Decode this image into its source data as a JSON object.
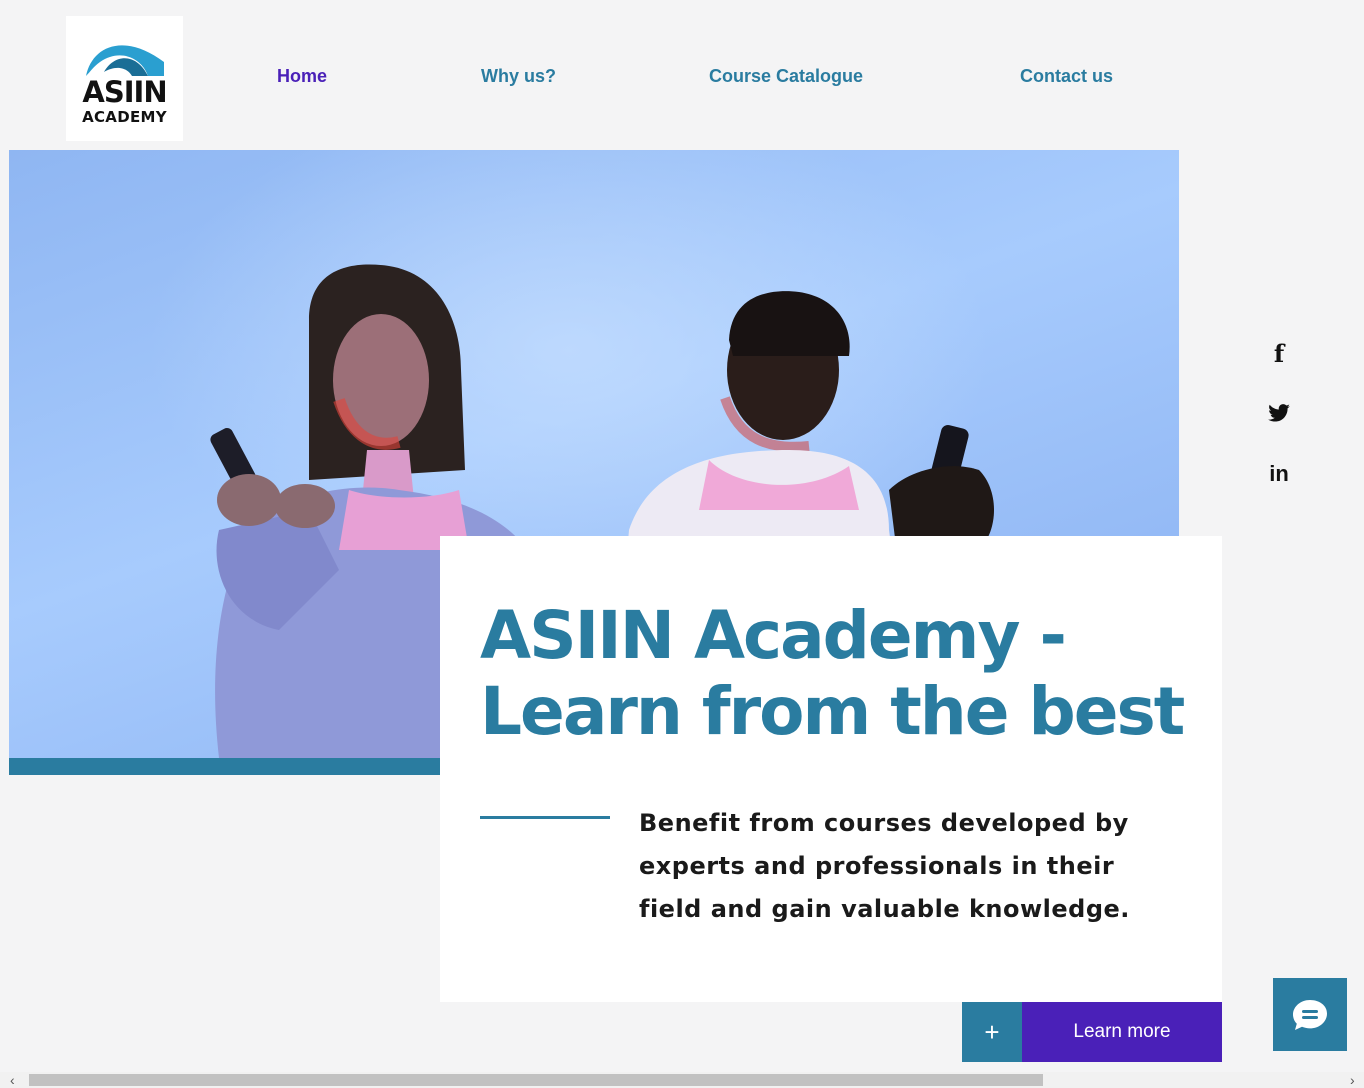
{
  "brand": {
    "logo_title": "ASIIN",
    "logo_subtitle": "ACADEMY",
    "colors": {
      "primary": "#2a7ca0",
      "accent": "#4a20b8"
    }
  },
  "nav": {
    "items": [
      {
        "label": "Home",
        "active": true
      },
      {
        "label": "Why us?"
      },
      {
        "label": "Course Catalogue"
      },
      {
        "label": "Contact us"
      }
    ]
  },
  "social": {
    "facebook_icon": "f",
    "linkedin_icon": "in",
    "icons": [
      "facebook-icon",
      "twitter-icon",
      "linkedin-icon"
    ]
  },
  "hero": {
    "headline_line1": "ASIIN Academy -",
    "headline_line2": "Learn from the best",
    "description": "Benefit from courses developed by experts and professionals in their field and gain valuable knowledge."
  },
  "cta": {
    "plus": "+",
    "label": "Learn more"
  },
  "scrollbar": {
    "left_arrow": "‹",
    "right_arrow": "›"
  }
}
